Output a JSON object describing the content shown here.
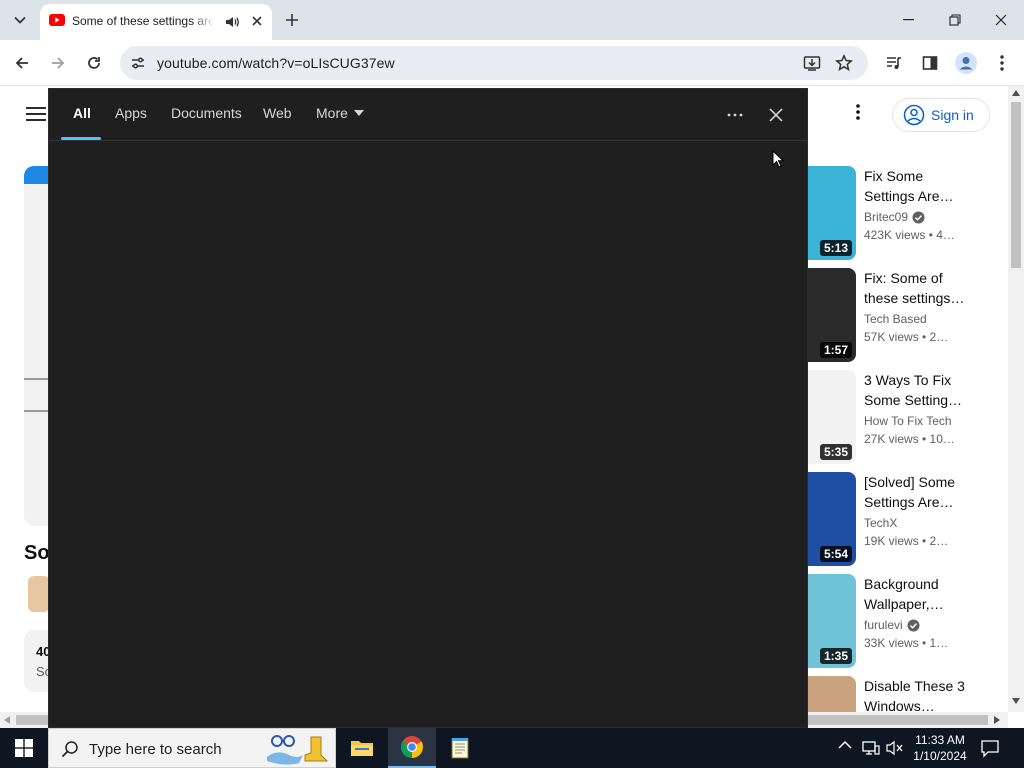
{
  "browser": {
    "tab_title": "Some of these settings are managed by your organization",
    "url": "youtube.com/watch?v=oLIsCUG37ew"
  },
  "youtube": {
    "sign_in_label": "Sign in",
    "partial_texts": {
      "heading_fragment": "So",
      "count_fragment": "40",
      "line_fragment": "So"
    },
    "recommendations": [
      {
        "title1": "Fix Some",
        "title2": "Settings Are…",
        "channel": "Britec09",
        "verified": true,
        "meta": "423K views  • 4…",
        "duration": "5:13",
        "thumb_color": "#3ab3d6"
      },
      {
        "title1": "Fix: Some of",
        "title2": "these settings…",
        "channel": "Tech Based",
        "verified": false,
        "meta": "57K views  • 2…",
        "duration": "1:57",
        "thumb_color": "#2a2a2a"
      },
      {
        "title1": "3 Ways To Fix",
        "title2": "Some Setting…",
        "channel": "How To Fix Tech",
        "verified": false,
        "meta": "27K views  • 10…",
        "duration": "5:35",
        "thumb_color": "#f2f2f2"
      },
      {
        "title1": "[Solved] Some",
        "title2": "Settings Are…",
        "channel": "TechX",
        "verified": false,
        "meta": "19K views  • 2…",
        "duration": "5:54",
        "thumb_color": "#1f4fa3"
      },
      {
        "title1": "Background",
        "title2": "Wallpaper,…",
        "channel": "furulevi",
        "verified": true,
        "meta": "33K views  • 1…",
        "duration": "1:35",
        "thumb_color": "#6fc3d8"
      },
      {
        "title1": "Disable These 3",
        "title2": "Windows…",
        "channel": "",
        "verified": false,
        "meta": "",
        "duration": "",
        "thumb_color": "#c9a27e"
      }
    ]
  },
  "search_flyout": {
    "tabs": [
      "All",
      "Apps",
      "Documents",
      "Web",
      "More"
    ]
  },
  "taskbar": {
    "search_placeholder": "Type here to search",
    "time": "11:33 AM",
    "date": "1/10/2024"
  }
}
